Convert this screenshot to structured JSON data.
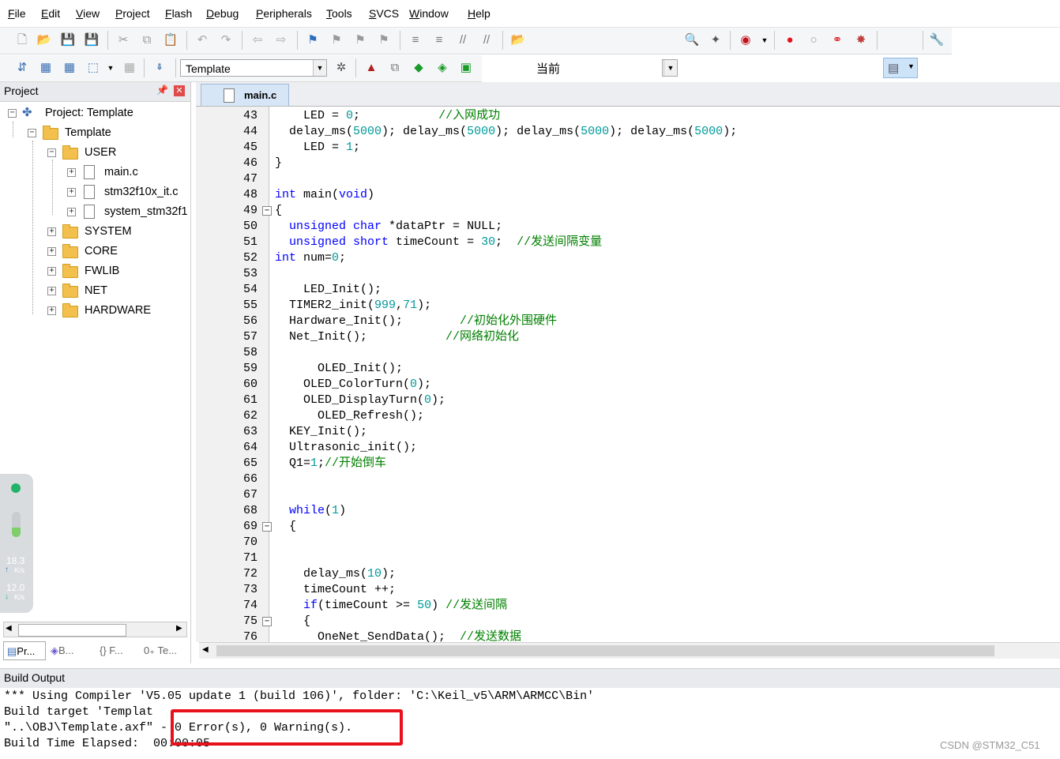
{
  "menu": [
    "File",
    "Edit",
    "View",
    "Project",
    "Flash",
    "Debug",
    "Peripherals",
    "Tools",
    "SVCS",
    "Window",
    "Help"
  ],
  "toolbar1": {
    "current_label": "当前"
  },
  "toolbar2": {
    "target_combo": "Template"
  },
  "project_panel": {
    "title": "Project",
    "tree": [
      {
        "label": "Project: Template",
        "level": 0,
        "kind": "project",
        "expander": "−"
      },
      {
        "label": "Template",
        "level": 1,
        "kind": "target",
        "expander": "−"
      },
      {
        "label": "USER",
        "level": 2,
        "kind": "folder",
        "expander": "−"
      },
      {
        "label": "main.c",
        "level": 3,
        "kind": "file",
        "expander": "+"
      },
      {
        "label": "stm32f10x_it.c",
        "level": 3,
        "kind": "file",
        "expander": "+"
      },
      {
        "label": "system_stm32f1",
        "level": 3,
        "kind": "file",
        "expander": "+"
      },
      {
        "label": "SYSTEM",
        "level": 2,
        "kind": "folder",
        "expander": "+"
      },
      {
        "label": "CORE",
        "level": 2,
        "kind": "folder",
        "expander": "+"
      },
      {
        "label": "FWLIB",
        "level": 2,
        "kind": "folder",
        "expander": "+"
      },
      {
        "label": "NET",
        "level": 2,
        "kind": "folder",
        "expander": "+"
      },
      {
        "label": "HARDWARE",
        "level": 2,
        "kind": "folder",
        "expander": "+"
      }
    ],
    "bottom_tabs": [
      "Pr...",
      "B...",
      "{} F...",
      "0₊ Te..."
    ]
  },
  "net_widget": {
    "up_value": "18.3",
    "up_unit": "K/s",
    "down_value": "12.0",
    "down_unit": "K/s"
  },
  "editor": {
    "tab": "main.c",
    "lines": [
      {
        "n": "43",
        "fold": "",
        "segs": [
          [
            "t",
            "    LED = "
          ],
          [
            "n",
            "0"
          ],
          [
            "t",
            ";           "
          ],
          [
            "c",
            "//入网成功"
          ]
        ]
      },
      {
        "n": "44",
        "fold": "",
        "segs": [
          [
            "t",
            "  delay_ms("
          ],
          [
            "n",
            "5000"
          ],
          [
            "t",
            "); delay_ms("
          ],
          [
            "n",
            "5000"
          ],
          [
            "t",
            "); delay_ms("
          ],
          [
            "n",
            "5000"
          ],
          [
            "t",
            "); delay_ms("
          ],
          [
            "n",
            "5000"
          ],
          [
            "t",
            ");"
          ]
        ]
      },
      {
        "n": "45",
        "fold": "",
        "segs": [
          [
            "t",
            "    LED = "
          ],
          [
            "n",
            "1"
          ],
          [
            "t",
            ";"
          ]
        ]
      },
      {
        "n": "46",
        "fold": "",
        "segs": [
          [
            "t",
            "}"
          ]
        ]
      },
      {
        "n": "47",
        "fold": "",
        "segs": []
      },
      {
        "n": "48",
        "fold": "",
        "segs": [
          [
            "k",
            "int"
          ],
          [
            "t",
            " main("
          ],
          [
            "k",
            "void"
          ],
          [
            "t",
            ")"
          ]
        ]
      },
      {
        "n": "49",
        "fold": "−",
        "segs": [
          [
            "t",
            "{"
          ]
        ]
      },
      {
        "n": "50",
        "fold": "",
        "segs": [
          [
            "t",
            "  "
          ],
          [
            "k",
            "unsigned char"
          ],
          [
            "t",
            " *dataPtr = NULL;"
          ]
        ]
      },
      {
        "n": "51",
        "fold": "",
        "segs": [
          [
            "t",
            "  "
          ],
          [
            "k",
            "unsigned short"
          ],
          [
            "t",
            " timeCount = "
          ],
          [
            "n",
            "30"
          ],
          [
            "t",
            ";  "
          ],
          [
            "c",
            "//发送间隔变量"
          ]
        ]
      },
      {
        "n": "52",
        "fold": "",
        "segs": [
          [
            "k",
            "int"
          ],
          [
            "t",
            " num="
          ],
          [
            "n",
            "0"
          ],
          [
            "t",
            ";"
          ]
        ]
      },
      {
        "n": "53",
        "fold": "",
        "segs": []
      },
      {
        "n": "54",
        "fold": "",
        "segs": [
          [
            "t",
            "    LED_Init();"
          ]
        ]
      },
      {
        "n": "55",
        "fold": "",
        "segs": [
          [
            "t",
            "  TIMER2_init("
          ],
          [
            "n",
            "999"
          ],
          [
            "t",
            ","
          ],
          [
            "n",
            "71"
          ],
          [
            "t",
            ");"
          ]
        ]
      },
      {
        "n": "56",
        "fold": "",
        "segs": [
          [
            "t",
            "  Hardware_Init();        "
          ],
          [
            "c",
            "//初始化外围硬件"
          ]
        ]
      },
      {
        "n": "57",
        "fold": "",
        "segs": [
          [
            "t",
            "  Net_Init();           "
          ],
          [
            "c",
            "//网络初始化"
          ]
        ]
      },
      {
        "n": "58",
        "fold": "",
        "segs": []
      },
      {
        "n": "59",
        "fold": "",
        "segs": [
          [
            "t",
            "      OLED_Init();"
          ]
        ]
      },
      {
        "n": "60",
        "fold": "",
        "segs": [
          [
            "t",
            "    OLED_ColorTurn("
          ],
          [
            "n",
            "0"
          ],
          [
            "t",
            ");"
          ]
        ]
      },
      {
        "n": "61",
        "fold": "",
        "segs": [
          [
            "t",
            "    OLED_DisplayTurn("
          ],
          [
            "n",
            "0"
          ],
          [
            "t",
            ");"
          ]
        ]
      },
      {
        "n": "62",
        "fold": "",
        "segs": [
          [
            "t",
            "      OLED_Refresh();"
          ]
        ]
      },
      {
        "n": "63",
        "fold": "",
        "segs": [
          [
            "t",
            "  KEY_Init();"
          ]
        ]
      },
      {
        "n": "64",
        "fold": "",
        "segs": [
          [
            "t",
            "  Ultrasonic_init();"
          ]
        ]
      },
      {
        "n": "65",
        "fold": "",
        "segs": [
          [
            "t",
            "  Q1="
          ],
          [
            "n",
            "1"
          ],
          [
            "t",
            ";"
          ],
          [
            "c",
            "//开始倒车"
          ]
        ]
      },
      {
        "n": "66",
        "fold": "",
        "segs": []
      },
      {
        "n": "67",
        "fold": "",
        "segs": []
      },
      {
        "n": "68",
        "fold": "",
        "segs": [
          [
            "t",
            "  "
          ],
          [
            "k",
            "while"
          ],
          [
            "t",
            "("
          ],
          [
            "n",
            "1"
          ],
          [
            "t",
            ")"
          ]
        ]
      },
      {
        "n": "69",
        "fold": "−",
        "segs": [
          [
            "t",
            "  {"
          ]
        ]
      },
      {
        "n": "70",
        "fold": "",
        "segs": []
      },
      {
        "n": "71",
        "fold": "",
        "segs": []
      },
      {
        "n": "72",
        "fold": "",
        "segs": [
          [
            "t",
            "    delay_ms("
          ],
          [
            "n",
            "10"
          ],
          [
            "t",
            ");"
          ]
        ]
      },
      {
        "n": "73",
        "fold": "",
        "segs": [
          [
            "t",
            "    timeCount ++;"
          ]
        ]
      },
      {
        "n": "74",
        "fold": "",
        "segs": [
          [
            "t",
            "    "
          ],
          [
            "k",
            "if"
          ],
          [
            "t",
            "(timeCount >= "
          ],
          [
            "n",
            "50"
          ],
          [
            "t",
            ") "
          ],
          [
            "c",
            "//发送间隔"
          ]
        ]
      },
      {
        "n": "75",
        "fold": "−",
        "segs": [
          [
            "t",
            "    {"
          ]
        ]
      },
      {
        "n": "76",
        "fold": "",
        "segs": [
          [
            "t",
            "      OneNet_SendData();  "
          ],
          [
            "c",
            "//发送数据"
          ]
        ]
      }
    ]
  },
  "build_output": {
    "title": "Build Output",
    "lines": [
      "*** Using Compiler 'V5.05 update 1 (build 106)', folder: 'C:\\Keil_v5\\ARM\\ARMCC\\Bin'",
      "Build target 'Templat",
      "\"..\\OBJ\\Template.axf\" - 0 Error(s), 0 Warning(s).",
      "Build Time Elapsed:  00:00:05"
    ],
    "highlight": "- 0 Error(s), 0 Warning(s)."
  },
  "watermark": "CSDN @STM32_C51",
  "colors": {
    "keyword": "#0000ff",
    "number": "#009999",
    "comment": "#008000",
    "highlight_box": "#e8101a"
  }
}
